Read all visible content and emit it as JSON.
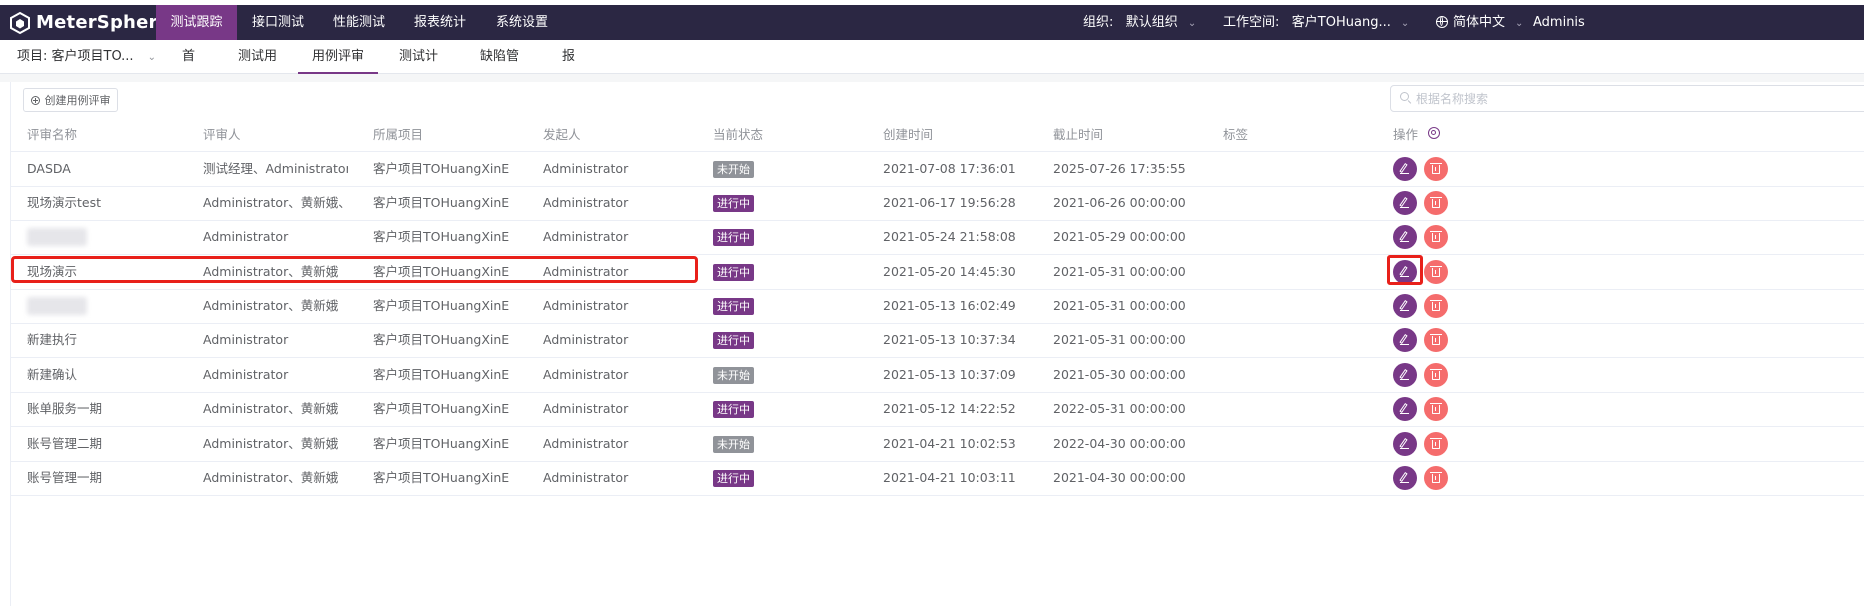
{
  "app": {
    "logo_text": "MeterSphere",
    "top_menu": [
      "测试跟踪",
      "接口测试",
      "性能测试",
      "报表统计",
      "系统设置"
    ],
    "active_top_menu": "测试跟踪",
    "org_label": "组织:",
    "org_value": "默认组织",
    "workspace_label": "工作空间:",
    "workspace_value": "客户TOHuang...",
    "language": "简体中文",
    "user": "Adminis"
  },
  "subnav": {
    "project": "项目: 客户项目TO...",
    "items": [
      "首页",
      "测试用例",
      "用例评审",
      "测试计划",
      "缺陷管理",
      "报告"
    ],
    "active": "用例评审"
  },
  "toolbar": {
    "create_label": "创建用例评审",
    "search_placeholder": "根据名称搜索"
  },
  "table": {
    "columns": {
      "name": "评审名称",
      "reviewer": "评审人",
      "project": "所属项目",
      "creator": "发起人",
      "status": "当前状态",
      "created": "创建时间",
      "deadline": "截止时间",
      "tags": "标签",
      "ops": "操作"
    },
    "rows": [
      {
        "name": "DASDA",
        "reviewer": "测试经理、Administrator...",
        "project": "客户项目TOHuangXinE",
        "creator": "Administrator",
        "status": "未开始",
        "created": "2021-07-08 17:36:01",
        "deadline": "2025-07-26 17:35:55"
      },
      {
        "name": "现场演示test",
        "reviewer": "Administrator、黄新娥、...",
        "project": "客户项目TOHuangXinE",
        "creator": "Administrator",
        "status": "进行中",
        "created": "2021-06-17 19:56:28",
        "deadline": "2021-06-26 00:00:00"
      },
      {
        "name": "",
        "reviewer": "Administrator",
        "project": "客户项目TOHuangXinE",
        "creator": "Administrator",
        "status": "进行中",
        "created": "2021-05-24 21:58:08",
        "deadline": "2021-05-29 00:00:00"
      },
      {
        "name": "现场演示",
        "reviewer": "Administrator、黄新娥",
        "project": "客户项目TOHuangXinE",
        "creator": "Administrator",
        "status": "进行中",
        "created": "2021-05-20 14:45:30",
        "deadline": "2021-05-31 00:00:00"
      },
      {
        "name": "",
        "reviewer": "Administrator、黄新娥",
        "project": "客户项目TOHuangXinE",
        "creator": "Administrator",
        "status": "进行中",
        "created": "2021-05-13 16:02:49",
        "deadline": "2021-05-31 00:00:00"
      },
      {
        "name": "新建执行",
        "reviewer": "Administrator",
        "project": "客户项目TOHuangXinE",
        "creator": "Administrator",
        "status": "进行中",
        "created": "2021-05-13 10:37:34",
        "deadline": "2021-05-31 00:00:00"
      },
      {
        "name": "新建确认",
        "reviewer": "Administrator",
        "project": "客户项目TOHuangXinE",
        "creator": "Administrator",
        "status": "未开始",
        "created": "2021-05-13 10:37:09",
        "deadline": "2021-05-30 00:00:00"
      },
      {
        "name": "账单服务一期",
        "reviewer": "Administrator、黄新娥",
        "project": "客户项目TOHuangXinE",
        "creator": "Administrator",
        "status": "进行中",
        "created": "2021-05-12 14:22:52",
        "deadline": "2022-05-31 00:00:00"
      },
      {
        "name": "账号管理二期",
        "reviewer": "Administrator、黄新娥",
        "project": "客户项目TOHuangXinE",
        "creator": "Administrator",
        "status": "未开始",
        "created": "2021-04-21 10:02:53",
        "deadline": "2022-04-30 00:00:00"
      },
      {
        "name": "账号管理一期",
        "reviewer": "Administrator、黄新娥",
        "project": "客户项目TOHuangXinE",
        "creator": "Administrator",
        "status": "进行中",
        "created": "2021-04-21 10:03:11",
        "deadline": "2021-04-30 00:00:00"
      }
    ]
  },
  "colors": {
    "nav_bg": "#2b2743",
    "accent": "#783887",
    "danger": "#f56c6c",
    "status_not_started": "#909399",
    "annotation": "#e8201a"
  }
}
